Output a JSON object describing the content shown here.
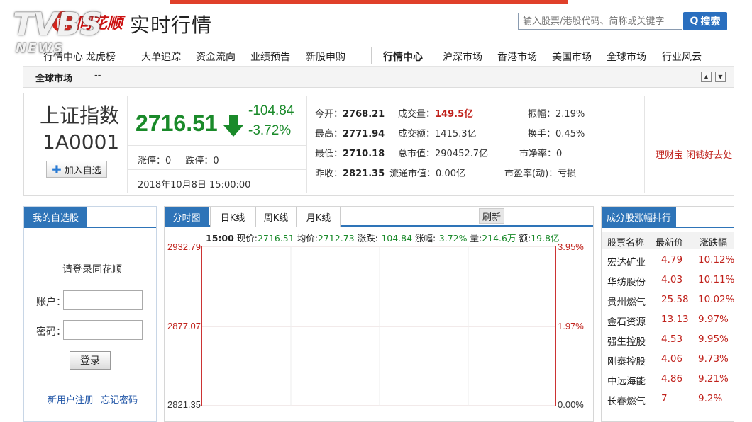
{
  "overlay": {
    "tvbs": "TVBS",
    "news": "NEWS"
  },
  "brand": {
    "logo_mark": "同",
    "logo_name": "同花顺",
    "page_title": "实时行情"
  },
  "search": {
    "placeholder": "输入股票/港股代码、简称或关键字",
    "button": "搜索"
  },
  "nav": {
    "items": [
      "行情中心",
      "龙虎榜",
      "大单追踪",
      "资金流向",
      "业绩预告",
      "新股申购"
    ],
    "items_right": [
      "行情中心",
      "沪深市场",
      "香港市场",
      "美国市场",
      "全球市场",
      "行业风云"
    ]
  },
  "subnav": {
    "label": "全球市场",
    "dash": "--"
  },
  "quote": {
    "name": "上证指数",
    "code": "1A0001",
    "add_button": "加入自选",
    "price": "2716.51",
    "change": "-104.84",
    "change_pct": "-3.72%",
    "limit_up": "涨停：0",
    "limit_down": "跌停：0",
    "datetime": "2018年10月8日  15:00:00",
    "stats": {
      "open_label": "今开：",
      "open": "2768.21",
      "high_label": "最高：",
      "high": "2771.94",
      "low_label": "最低：",
      "low": "2710.18",
      "prev_label": "昨收：",
      "prev": "2821.35",
      "vol_label": "成交量：",
      "vol": "149.5亿",
      "amt_label": "成交额：",
      "amt": "1415.3亿",
      "mcap_label": "总市值：",
      "mcap": "290452.7亿",
      "float_label": "流通市值：",
      "float": "0.00亿",
      "amp_label": "振幅：",
      "amp": "2.19%",
      "turn_label": "换手：",
      "turn": "0.45%",
      "pb_label": "市净率：",
      "pb": "0",
      "pe_label": "市盈率(动)：",
      "pe": "亏损"
    },
    "promo": "理财宝 闲钱好去处"
  },
  "watchlist": {
    "tab": "我的自选股",
    "title": "请登录同花顺",
    "account_label": "账户：",
    "password_label": "密码：",
    "login_button": "登录",
    "register_link": "新用户注册",
    "forgot_link": "忘记密码"
  },
  "chart": {
    "tabs": [
      "分时图",
      "日K线",
      "周K线",
      "月K线"
    ],
    "refresh": "刷新",
    "info": {
      "time": "15:00",
      "now_label": "现价:",
      "now": "2716.51",
      "avg_label": "均价:",
      "avg": "2712.73",
      "chg_label": "涨跌:",
      "chg": "-104.84",
      "pct_label": "涨幅:",
      "pct": "-3.72%",
      "vol_label": "量:",
      "vol": "214.6万",
      "amt_label": "额:",
      "amt": "19.8亿"
    },
    "y_left": [
      "2932.79",
      "2877.07",
      "2821.35"
    ],
    "y_right": [
      "3.95%",
      "1.97%",
      "0.00%"
    ]
  },
  "constituents": {
    "tab": "成分股涨幅排行",
    "headers": [
      "股票名称",
      "最新价",
      "涨跌幅"
    ],
    "rows": [
      {
        "name": "宏达矿业",
        "price": "4.79",
        "chg": "10.12%"
      },
      {
        "name": "华纺股份",
        "price": "4.03",
        "chg": "10.11%"
      },
      {
        "name": "贵州燃气",
        "price": "25.58",
        "chg": "10.02%"
      },
      {
        "name": "金石资源",
        "price": "13.13",
        "chg": "9.97%"
      },
      {
        "name": "强生控股",
        "price": "4.53",
        "chg": "9.95%"
      },
      {
        "name": "刚泰控股",
        "price": "4.06",
        "chg": "9.73%"
      },
      {
        "name": "中远海能",
        "price": "4.86",
        "chg": "9.21%"
      },
      {
        "name": "长春燃气",
        "price": "7",
        "chg": "9.2%"
      }
    ]
  },
  "colors": {
    "up": "#c0211b",
    "down": "#1a8a2a",
    "accent": "#2e74b8"
  }
}
